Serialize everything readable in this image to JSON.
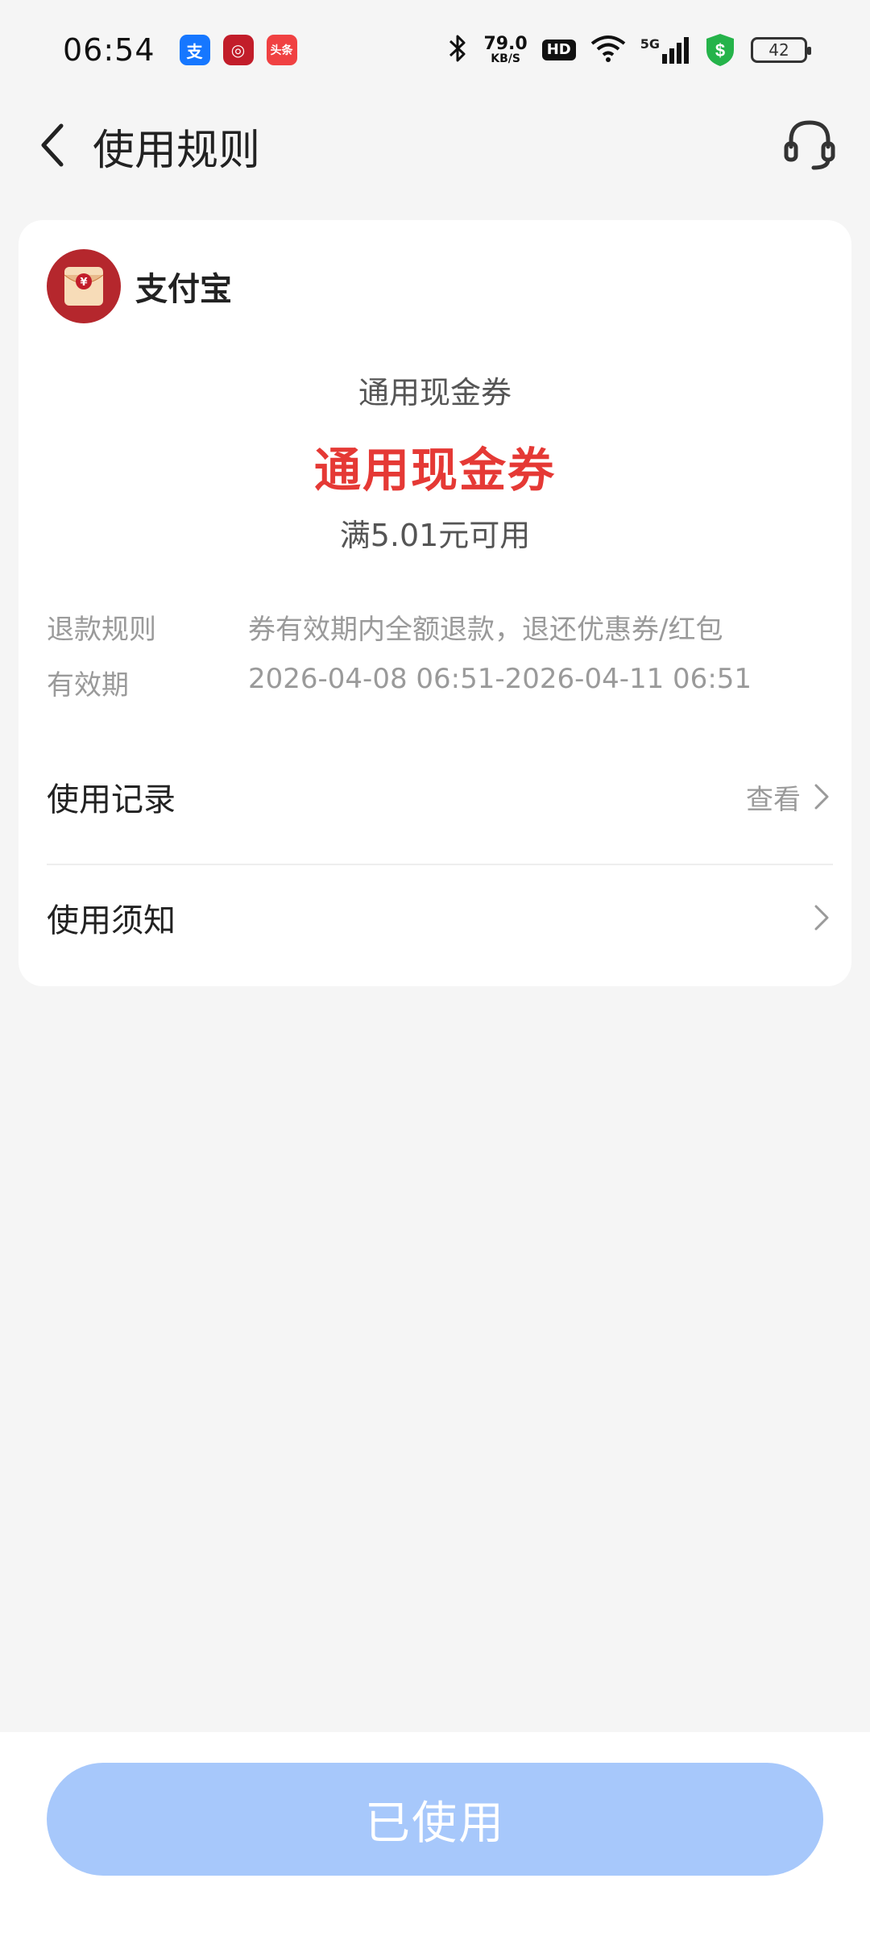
{
  "status_bar": {
    "time": "06:54",
    "speed_value": "79.0",
    "speed_unit": "KB/S",
    "hd_label": "HD",
    "network_label": "5G",
    "battery": "42",
    "apps": [
      {
        "name": "alipay-app-icon",
        "glyph": "支"
      },
      {
        "name": "boc-app-icon",
        "glyph": "◎"
      },
      {
        "name": "toutiao-app-icon",
        "glyph": "头条"
      }
    ]
  },
  "header": {
    "title": "使用规则"
  },
  "card": {
    "brand_name": "支付宝",
    "coupon_subtitle": "通用现金券",
    "coupon_title": "通用现金券",
    "coupon_condition": "满5.01元可用",
    "info": [
      {
        "label": "退款规则",
        "value": "券有效期内全额退款，退还优惠券/红包"
      },
      {
        "label": "有效期",
        "value": "2026-04-08 06:51-2026-04-11 06:51"
      }
    ],
    "links": {
      "usage_record": {
        "label": "使用记录",
        "hint": "查看"
      },
      "usage_notice": {
        "label": "使用须知"
      }
    }
  },
  "bottom": {
    "button_label": "已使用"
  },
  "colors": {
    "accent_red": "#e53935",
    "button_blue_disabled": "#a7c8fb",
    "brand_red": "#b5272d"
  }
}
